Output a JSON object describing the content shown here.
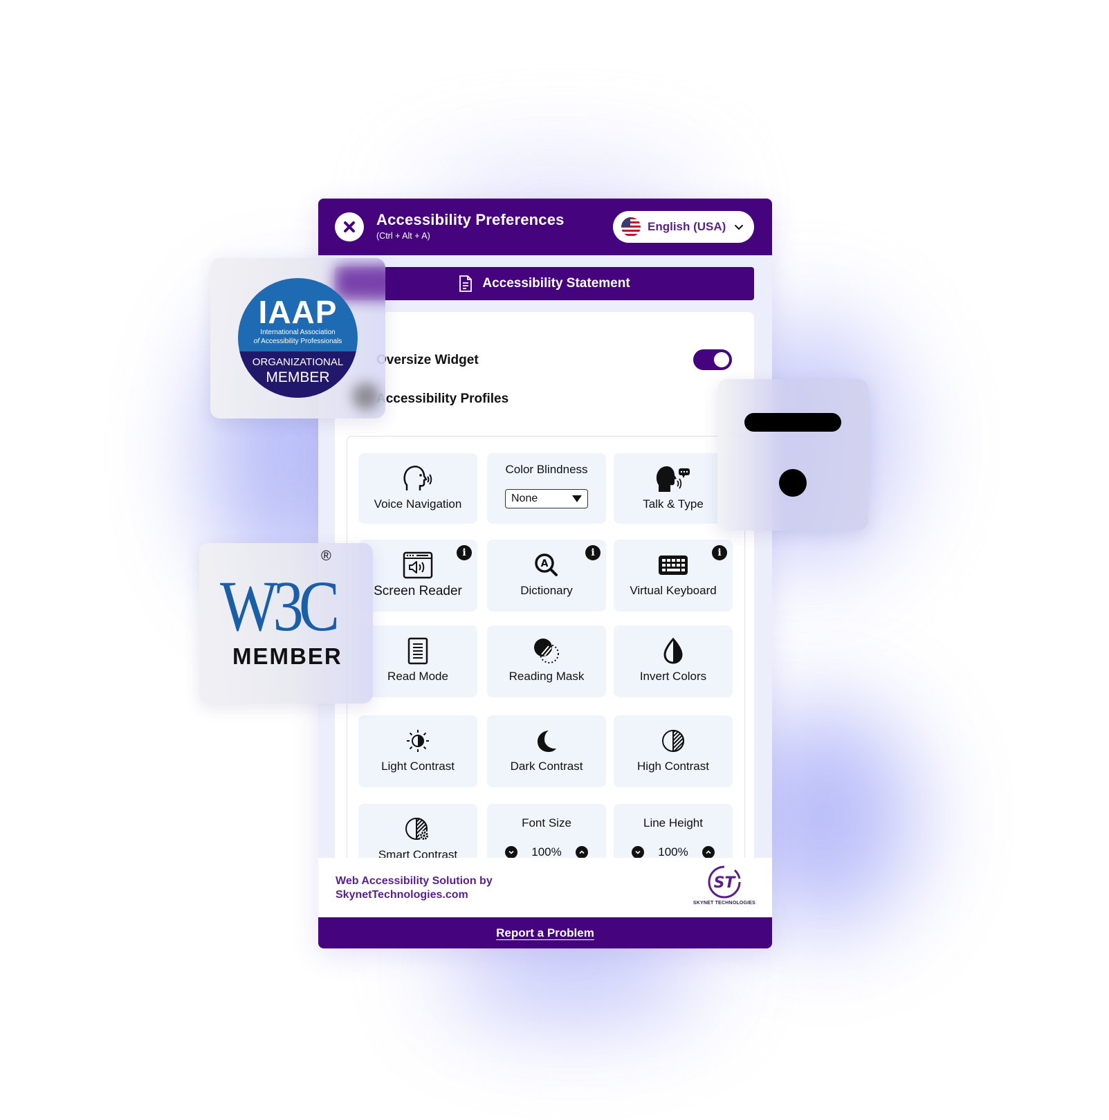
{
  "header": {
    "title": "Accessibility Preferences",
    "shortcut": "(Ctrl + Alt + A)",
    "close_icon": "close-icon",
    "language": {
      "selected": "English (USA)",
      "flag_icon": "us-flag-icon",
      "chevron_icon": "chevron-down-icon"
    }
  },
  "statement": {
    "label": "Accessibility Statement",
    "icon": "document-icon"
  },
  "settings": {
    "oversize_widget": {
      "label": "Oversize Widget",
      "enabled": true
    },
    "profiles_label": "Accessibility Profiles"
  },
  "tiles": [
    {
      "label": "Voice Navigation",
      "icon": "voice-navigation-icon"
    },
    {
      "label": "Color Blindness",
      "select_value": "None",
      "icon": "dropdown-triangle-icon"
    },
    {
      "label": "Talk & Type",
      "icon": "talk-type-icon"
    },
    {
      "label": "Screen Reader",
      "icon": "screen-reader-icon",
      "info": "i"
    },
    {
      "label": "Dictionary",
      "icon": "dictionary-icon",
      "info": "i"
    },
    {
      "label": "Virtual Keyboard",
      "icon": "keyboard-icon",
      "info": "i"
    },
    {
      "label": "Read Mode",
      "icon": "read-mode-icon"
    },
    {
      "label": "Reading Mask",
      "icon": "reading-mask-icon"
    },
    {
      "label": "Invert Colors",
      "icon": "invert-colors-icon"
    },
    {
      "label": "Light Contrast",
      "icon": "light-contrast-icon"
    },
    {
      "label": "Dark Contrast",
      "icon": "dark-contrast-icon"
    },
    {
      "label": "High Contrast",
      "icon": "high-contrast-icon"
    },
    {
      "label": "Smart Contrast",
      "icon": "smart-contrast-icon"
    },
    {
      "label": "Font Size",
      "value": "100%"
    },
    {
      "label": "Line Height",
      "value": "100%"
    }
  ],
  "footer": {
    "attribution_line1": "Web Accessibility Solution by",
    "attribution_line2": "SkynetTechnologies.com",
    "logo_text": "ST",
    "logo_caption": "SKYNET TECHNOLOGIES",
    "report_label": "Report a Problem"
  },
  "badges": {
    "iaap": {
      "logo": "IAAP",
      "subtitle_line1": "International Association",
      "subtitle_line2_italic": "of",
      "subtitle_line2": "Accessibility Professionals",
      "line1": "ORGANIZATIONAL",
      "line2": "MEMBER"
    },
    "w3c": {
      "logo": "W3C",
      "registered": "®",
      "member": "MEMBER"
    }
  },
  "colors": {
    "brand_purple": "#45047e",
    "text_purple": "#5a1f8f",
    "tile_background": "#f0f5fc",
    "iaap_blue": "#1f6bb3",
    "iaap_navy": "#22186b",
    "w3c_blue": "#1a5ea8"
  }
}
